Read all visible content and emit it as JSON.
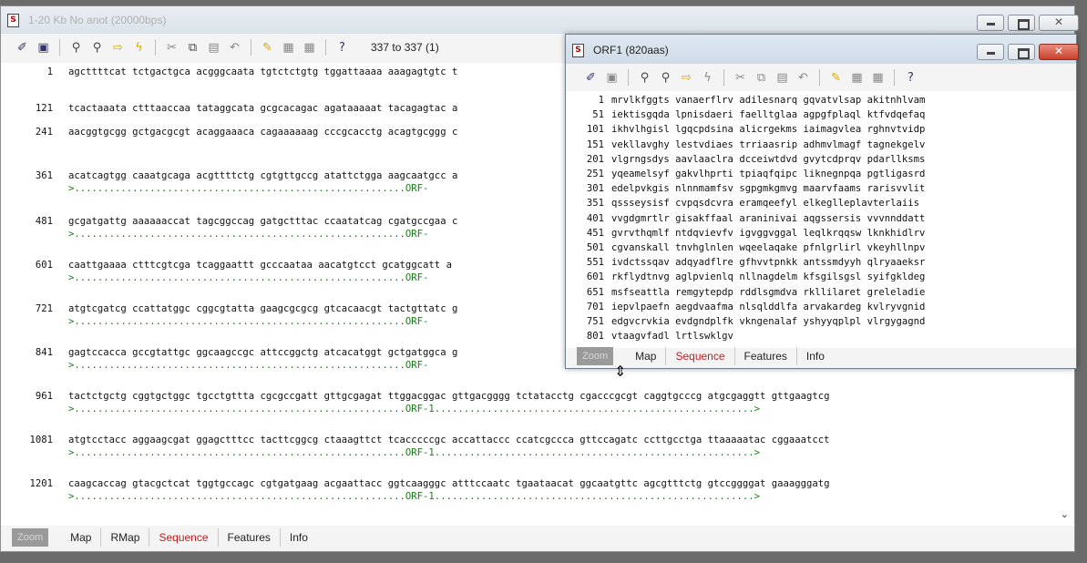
{
  "main_window": {
    "title": "1-20 Kb No anot (20000bps)",
    "position_readout": "337 to 337 (1)",
    "toolbar_icons": [
      "pointer-icon",
      "new-window-icon",
      "find-icon",
      "find-next-icon",
      "goto-icon",
      "lightning-icon",
      "cut-icon",
      "copy-icon",
      "paste-icon",
      "undo-icon",
      "pencil-icon",
      "edit-icon",
      "edit2-icon",
      "help-icon"
    ],
    "sequence_rows": [
      {
        "num": "1",
        "seq": "agcttttcat tctgactgca acgggcaata tgtctctgtg tggattaaaa aaagagtgtc t",
        "orf": ""
      },
      {
        "num": "121",
        "seq": "tcactaaata ctttaaccaa tataggcata gcgcacagac agataaaaat tacagagtac a",
        "orf": ""
      },
      {
        "num": "241",
        "seq": "aacggtgcgg gctgacgcgt acaggaaaca cagaaaaaag cccgcacctg acagtgcggg c",
        "orf": ""
      },
      {
        "num": "361",
        "seq": "acatcagtgg caaatgcaga acgttttctg cgtgttgccg atattctgga aagcaatgcc a",
        "orf": ">.........................................................ORF-"
      },
      {
        "num": "481",
        "seq": "gcgatgattg aaaaaaccat tagcggccag gatgctttac ccaatatcag cgatgccgaa c",
        "orf": ">.........................................................ORF-"
      },
      {
        "num": "601",
        "seq": "caattgaaaa ctttcgtcga tcaggaattt gcccaataa aacatgtcct gcatggcatt a",
        "orf": ">.........................................................ORF-"
      },
      {
        "num": "721",
        "seq": "atgtcgatcg ccattatggc cggcgtatta gaagcgcgcg gtcacaacgt tactgttatc g",
        "orf": ">.........................................................ORF-"
      },
      {
        "num": "841",
        "seq": "gagtccacca gccgtattgc ggcaagccgc attccggctg atcacatggt gctgatggca g",
        "orf": ">.........................................................ORF-"
      },
      {
        "num": "961",
        "seq": "tactctgctg cggtgctggc tgcctgttta cgcgccgatt gttgcgagat ttggacggac gttgacgggg tctatacctg cgacccgcgt caggtgcccg atgcgaggtt gttgaagtcg",
        "orf": ">.........................................................ORF-1.......................................................>"
      },
      {
        "num": "1081",
        "seq": "atgtcctacc aggaagcgat ggagctttcc tacttcggcg ctaaagttct tcacccccgc accattaccc ccatcgccca gttccagatc ccttgcctga ttaaaaatac cggaaatcct",
        "orf": ">.........................................................ORF-1.......................................................>"
      },
      {
        "num": "1201",
        "seq": "caagcaccag gtacgctcat tggtgccagc cgtgatgaag acgaattacc ggtcaagggc atttccaatc tgaataacat ggcaatgttc agcgtttctg gtccggggat gaaagggatg",
        "orf": ">.........................................................ORF-1.......................................................>"
      }
    ],
    "tabs": [
      "Zoom",
      "Map",
      "RMap",
      "Sequence",
      "Features",
      "Info"
    ],
    "active_tab": "Sequence"
  },
  "orf_window": {
    "title": "ORF1 (820aas)",
    "toolbar_icons": [
      "pointer-icon",
      "new-window-icon",
      "find-icon",
      "find-next-icon",
      "goto-icon",
      "lightning-icon",
      "cut-icon",
      "copy-icon",
      "paste-icon",
      "undo-icon",
      "pencil-icon",
      "edit-icon",
      "edit2-icon",
      "help-icon"
    ],
    "aa_rows": [
      {
        "num": "1",
        "seq": "mrvlkfggts vanaerflrv adilesnarq gqvatvlsap akitnhlvam"
      },
      {
        "num": "51",
        "seq": "iektisgqda lpnisdaeri faelltglaa agpgfplaql ktfvdqefaq"
      },
      {
        "num": "101",
        "seq": "ikhvlhgisl lgqcpdsina alicrgekms iaimagvlea rghnvtvidp"
      },
      {
        "num": "151",
        "seq": "vekllavghy lestvdiaes trriaasrip adhmvlmagf tagnekgelv"
      },
      {
        "num": "201",
        "seq": "vlgrngsdys aavlaaclra dcceiwtdvd gvytcdprqv pdarllksms"
      },
      {
        "num": "251",
        "seq": "yqeamelsyf gakvlhprti tpiaqfqipc liknegnpqa pgtligasrd"
      },
      {
        "num": "301",
        "seq": "edelpvkgis nlnnmamfsv sgpgmkgmvg maarvfaams rarisvvlit"
      },
      {
        "num": "351",
        "seq": "qssseysisf cvpqsdcvra eramqeefyl elkeglleplavterlaiis"
      },
      {
        "num": "401",
        "seq": "vvgdgmrtlr gisakffaal araninivai aqgssersis vvvnnddatt"
      },
      {
        "num": "451",
        "seq": "gvrvthqmlf ntdqvievfv igvggvggal leqlkrqqsw lknkhidlrv"
      },
      {
        "num": "501",
        "seq": "cgvanskall tnvhglnlen wqeelaqake pfnlgrlirl vkeyhllnpv"
      },
      {
        "num": "551",
        "seq": "ivdctssqav adqyadflre gfhvvtpnkk antssmdyyh qlryaaeksr"
      },
      {
        "num": "601",
        "seq": "rkflydtnvg aglpvienlq nllnagdelm kfsgilsgsl syifgkldeg"
      },
      {
        "num": "651",
        "seq": "msfseattla remgytepdp rddlsgmdva rkllilaret greleladie"
      },
      {
        "num": "701",
        "seq": "iepvlpaefn aegdvaafma nlsqlddlfa arvakardeg kvlryvgnid"
      },
      {
        "num": "751",
        "seq": "edgvcrvkia evdgndplfk vkngenalaf yshyyqplpl vlrgygagnd"
      },
      {
        "num": "801",
        "seq": "vtaagvfadl lrtlswklgv"
      }
    ],
    "tabs": [
      "Zoom",
      "Map",
      "Sequence",
      "Features",
      "Info"
    ],
    "active_tab": "Sequence"
  }
}
